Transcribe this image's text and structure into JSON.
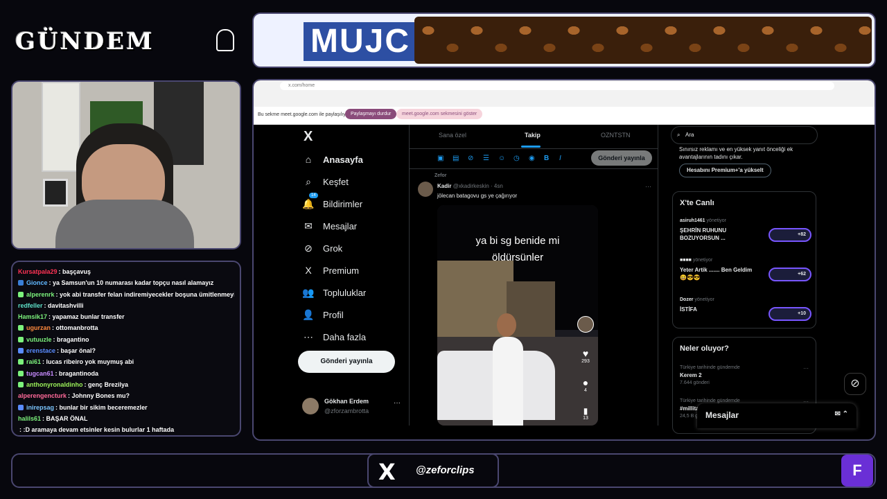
{
  "overlay": {
    "title": "GÜNDEM",
    "social_handle": "@zeforclips",
    "x_logo": "X",
    "corner_logo": "F"
  },
  "banner": {
    "brand": "MUJC"
  },
  "chat": [
    {
      "user": "Kursatpala29",
      "color": "#ff3355",
      "text": "başçavuş",
      "badge": ""
    },
    {
      "user": "Gionce",
      "color": "#61b8ff",
      "text": "ya Samsun'un 10 numarası kadar topçu nasıl alamayız",
      "badge": "#3a7fd6"
    },
    {
      "user": "alperenrk",
      "color": "#7cf27c",
      "text": "yok abi transfer felan indiremiyecekler boşuna ümitlenmeyin",
      "badge": "#7cf27c"
    },
    {
      "user": "redfeller",
      "color": "#5ee0c8",
      "text": "davitashvilli",
      "badge": ""
    },
    {
      "user": "Hamsik17",
      "color": "#7cf27c",
      "text": "yapamaz bunlar transfer",
      "badge": ""
    },
    {
      "user": "ugurzan",
      "color": "#ff8a3d",
      "text": "ottomanbrotta",
      "badge": "#7cf27c"
    },
    {
      "user": "vutuuzle",
      "color": "#7cf27c",
      "text": "bragantino",
      "badge": "#7cf27c"
    },
    {
      "user": "erenstace",
      "color": "#5a8cff",
      "text": "başar önal?",
      "badge": "#5a8cff"
    },
    {
      "user": "rai61",
      "color": "#7cf27c",
      "text": "lucas ribeiro yok muymuş abi",
      "badge": "#7cf27c"
    },
    {
      "user": "tugcan61",
      "color": "#c78bff",
      "text": "bragantinoda",
      "badge": "#7cf27c"
    },
    {
      "user": "anthonyronaldinho",
      "color": "#9cf25a",
      "text": "genç Brezilya",
      "badge": "#7cf27c"
    },
    {
      "user": "alperengencturk",
      "color": "#ff6a9a",
      "text": "Johnny Bones mu?",
      "badge": ""
    },
    {
      "user": "inirepsag",
      "color": "#7cc6ff",
      "text": "bunlar bir sikim beceremezler",
      "badge": "#5a8cff"
    },
    {
      "user": "halils61",
      "color": "#7cf27c",
      "text": "BAŞAR ÖNAL",
      "badge": ""
    },
    {
      "user": "",
      "color": "#ffffff",
      "text": ":D aramaya devam etsinler kesin bulurlar 1 haftada",
      "badge": ""
    }
  ],
  "browser": {
    "url": "x.com/home",
    "share_text": "Bu sekme meet.google.com ile paylaşılıyor",
    "stop_share": "Paylaşmayı durdur",
    "show_tab": "meet.google.com sekmesini göster"
  },
  "x_nav": {
    "logo": "X",
    "items": [
      "Anasayfa",
      "Keşfet",
      "Bildirimler",
      "Mesajlar",
      "Grok",
      "Premium",
      "Topluluklar",
      "Profil",
      "Daha fazla"
    ],
    "notif_count": "14",
    "post_button": "Gönderi yayınla",
    "profile_name": "Gökhan Erdem",
    "profile_handle": "@zforzambrotta"
  },
  "feed": {
    "tabs": [
      "Sana özel",
      "Takip",
      "OZNTSTN"
    ],
    "active_tab": 1,
    "compose_button": "Gönderi yayınla",
    "post": {
      "retweeted_by": "Zefor",
      "author": "Kadir",
      "handle": "@xkadirkeskin · 4sn",
      "text": "jölecan batagovu gs ye çağırıyor",
      "caption_line1": "ya bi sg benide mi",
      "caption_line2": "öldürsünler",
      "likes": "293",
      "comments": "4",
      "saves": "13"
    }
  },
  "right": {
    "search_placeholder": "Ara",
    "premium_text": "Sınırsız reklamı ve en yüksek yanıt önceliği ek avantajlarının tadını çıkar.",
    "premium_button": "Hesabını Premium+'a yükselt",
    "live_title": "X'te Canlı",
    "live": [
      {
        "host": "asiruh1461",
        "role": "yönetiyor",
        "title": "ŞEHRİN RUHUNU BOZUYORSUN ...",
        "count": "+82"
      },
      {
        "host": "■■■■",
        "role": "yönetiyor",
        "title": "Yeter Artik ....... Ben Geldim😆😎😎",
        "count": "+62"
      },
      {
        "host": "Dozer",
        "role": "yönetiyor",
        "title": "İSTİFA",
        "count": "+10"
      }
    ],
    "trends_title": "Neler oluyor?",
    "trends": [
      {
        "category": "Türkiye tarihinde gündemde",
        "name": "Kerem 2",
        "count": "7.644 gönderi"
      },
      {
        "category": "Türkiye tarihinde gündemde",
        "name": "#millita",
        "count": "24,5 B gö"
      }
    ],
    "messages": "Mesajlar"
  }
}
